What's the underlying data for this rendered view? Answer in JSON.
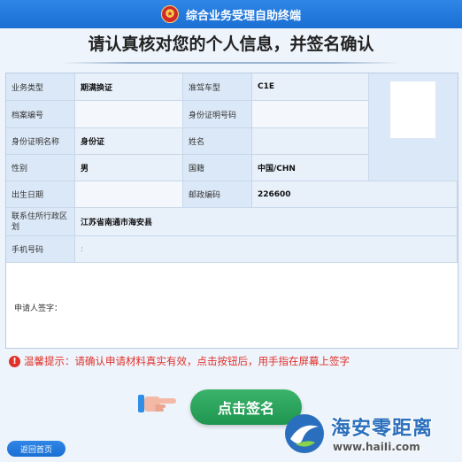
{
  "header": {
    "title": "综合业务受理自助终端"
  },
  "headline": "请认真核对您的个人信息，并签名确认",
  "form": {
    "business_type_label": "业务类型",
    "business_type_value": "期满换证",
    "vehicle_type_label": "准驾车型",
    "vehicle_type_value": "C1E",
    "file_no_label": "档案编号",
    "file_no_value": "",
    "id_no_label": "身份证明号码",
    "id_no_value": "",
    "id_name_label": "身份证明名称",
    "id_name_value": "身份证",
    "name_label": "姓名",
    "name_value": "",
    "gender_label": "性别",
    "gender_value": "男",
    "nationality_label": "国籍",
    "nationality_value": "中国/CHN",
    "birth_label": "出生日期",
    "birth_value": "",
    "postal_label": "邮政编码",
    "postal_value": "226600",
    "address_label": "联系住所行政区划",
    "address_value": "江苏省南通市海安县",
    "phone_label": "手机号码",
    "phone_value": ":",
    "signature_label": "申请人签字："
  },
  "tip": {
    "text": "温馨提示：请确认申请材料真实有效，点击按钮后，用手指在屏幕上签字"
  },
  "buttons": {
    "sign": "点击签名",
    "back": "返回首页"
  },
  "watermark": {
    "text": "海安零距离",
    "url": "www.haiIi.com"
  },
  "colors": {
    "primary": "#1a6fd3",
    "success": "#1f9650",
    "warning": "#e0312b"
  }
}
